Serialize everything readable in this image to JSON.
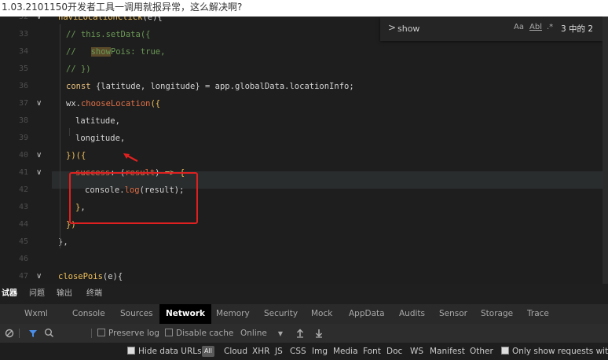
{
  "question": {
    "title": "1.03.2101150开发者工具一调用就报异常，这么解决啊?"
  },
  "editor": {
    "lines": [
      {
        "num": "32",
        "fold": "∨",
        "tokens": [
          {
            "c": "yel",
            "t": "naviLocationClick"
          },
          {
            "c": "plain",
            "t": "(e){"
          }
        ]
      },
      {
        "num": "33",
        "fold": "",
        "tokens": [
          {
            "c": "cmt",
            "t": "// this.setData({"
          }
        ]
      },
      {
        "num": "34",
        "fold": "",
        "tokens": [
          {
            "c": "cmt",
            "t": "//   "
          },
          {
            "c": "cmt hl",
            "t": "show"
          },
          {
            "c": "cmt",
            "t": "Pois: true,"
          }
        ]
      },
      {
        "num": "35",
        "fold": "",
        "tokens": [
          {
            "c": "cmt",
            "t": "// })"
          }
        ]
      },
      {
        "num": "36",
        "fold": "",
        "tokens": [
          {
            "c": "kw",
            "t": "const "
          },
          {
            "c": "plain",
            "t": "{latitude, longitude} = app.globalData.locationInfo;"
          }
        ]
      },
      {
        "num": "37",
        "fold": "∨",
        "tokens": [
          {
            "c": "plain",
            "t": "wx."
          },
          {
            "c": "fn",
            "t": "chooseLocation"
          },
          {
            "c": "yel",
            "t": "({"
          }
        ]
      },
      {
        "num": "38",
        "fold": "",
        "tokens": [
          {
            "c": "plain",
            "t": "latitude,"
          }
        ]
      },
      {
        "num": "39",
        "fold": "",
        "tokens": [
          {
            "c": "plain",
            "t": "longitude,"
          }
        ]
      },
      {
        "num": "40",
        "fold": "∨",
        "tokens": [
          {
            "c": "yel",
            "t": "})({"
          }
        ]
      },
      {
        "num": "41",
        "fold": "∨",
        "tokens": [
          {
            "c": "fn",
            "t": "success"
          },
          {
            "c": "plain",
            "t": ": ("
          },
          {
            "c": "prm",
            "t": "result"
          },
          {
            "c": "plain",
            "t": ") "
          },
          {
            "c": "kw",
            "t": "=>"
          },
          {
            "c": "plain",
            "t": " "
          },
          {
            "c": "yel",
            "t": "{"
          }
        ]
      },
      {
        "num": "42",
        "fold": "",
        "tokens": [
          {
            "c": "plain",
            "t": "console."
          },
          {
            "c": "fn",
            "t": "log"
          },
          {
            "c": "plain",
            "t": "(result);"
          }
        ]
      },
      {
        "num": "43",
        "fold": "",
        "tokens": [
          {
            "c": "yel",
            "t": "}"
          },
          {
            "c": "plain",
            "t": ","
          }
        ]
      },
      {
        "num": "44",
        "fold": "",
        "tokens": [
          {
            "c": "yel",
            "t": "})"
          }
        ]
      },
      {
        "num": "45",
        "fold": "",
        "tokens": [
          {
            "c": "plain",
            "t": "},"
          }
        ]
      },
      {
        "num": "46",
        "fold": "",
        "tokens": []
      },
      {
        "num": "47",
        "fold": "∨",
        "tokens": [
          {
            "c": "yel",
            "t": "closePois"
          },
          {
            "c": "plain",
            "t": "(e){"
          }
        ]
      }
    ]
  },
  "find_widget": {
    "chevron": ">",
    "query": "show",
    "match_case": "Aa",
    "whole_word": "Abl",
    "regex": ".*",
    "count": "3 中的 2"
  },
  "panel_tabs": [
    "试器",
    "问题",
    "输出",
    "终端"
  ],
  "devtools_tabs": [
    "Wxml",
    "Console",
    "Sources",
    "Network",
    "Memory",
    "Security",
    "Mock",
    "AppData",
    "Audits",
    "Sensor",
    "Storage",
    "Trace"
  ],
  "devtools_active": "Network",
  "toolbar": {
    "preserve_log": "Preserve log",
    "disable_cache": "Disable cache",
    "online": "Online",
    "dropdown": "▼"
  },
  "filter": {
    "hide_data_urls": "Hide data URLs",
    "all": "All",
    "types": [
      "Cloud",
      "XHR",
      "JS",
      "CSS",
      "Img",
      "Media",
      "Font",
      "Doc",
      "WS",
      "Manifest",
      "Other"
    ],
    "only_show": "Only show requests wit"
  },
  "colors": {
    "highlight_box": "#e02020",
    "editor_bg": "#1e1e1e",
    "active_tab_bg": "#000000"
  }
}
